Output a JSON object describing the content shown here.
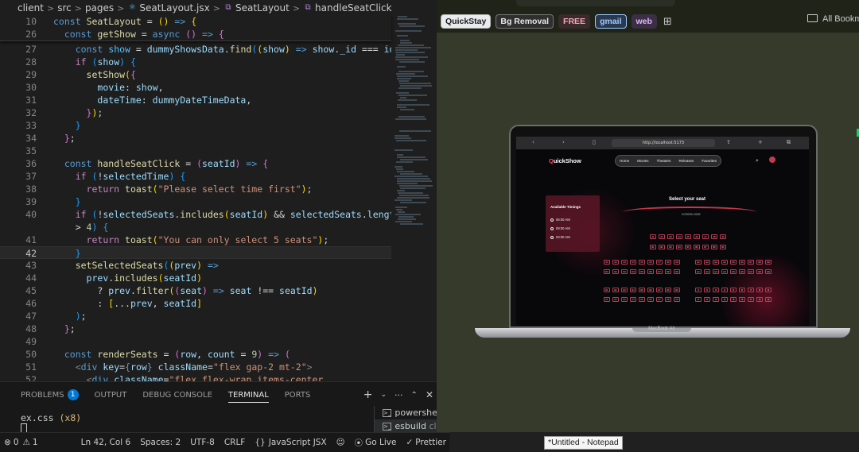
{
  "editor": {
    "breadcrumb": [
      "client",
      "src",
      "pages",
      "SeatLayout.jsx",
      "SeatLayout",
      "handleSeatClick"
    ],
    "sticky": [
      {
        "ln": "10",
        "html": "<span class='k'>const</span> <span class='f'>SeatLayout</span> = <span class='y'>()</span> <span class='k'>=&gt;</span> <span class='y'>{</span>"
      },
      {
        "ln": "26",
        "html": "  <span class='k'>const</span> <span class='f'>getShow</span> = <span class='k'>async</span> <span class='p'>()</span> <span class='k'>=&gt;</span> <span class='p'>{</span>"
      }
    ],
    "lines": [
      {
        "ln": "27",
        "html": "    <span class='k'>const</span> <span class='cst'>show</span> = <span class='v'>dummyShowsData</span>.<span class='f'>find</span><span class='b'>(</span><span class='y'>(</span><span class='v'>show</span><span class='y'>)</span> <span class='k'>=&gt;</span> <span class='v'>show</span>.<span class='v'>_id</span> === <span class='v'>id</span><span class='b'>)</span>;"
      },
      {
        "ln": "28",
        "html": "    <span class='c'>if</span> <span class='b'>(</span><span class='v'>show</span><span class='b'>)</span> <span class='b'>{</span>"
      },
      {
        "ln": "29",
        "html": "      <span class='f'>setShow</span><span class='y'>(</span><span class='p'>{</span>"
      },
      {
        "ln": "30",
        "html": "        <span class='v'>movie</span>: <span class='v'>show</span>,"
      },
      {
        "ln": "31",
        "html": "        <span class='v'>dateTime</span>: <span class='v'>dummyDateTimeData</span>,"
      },
      {
        "ln": "32",
        "html": "      <span class='p'>}</span><span class='y'>)</span>;"
      },
      {
        "ln": "33",
        "html": "    <span class='b'>}</span>"
      },
      {
        "ln": "34",
        "html": "  <span class='p'>}</span>;"
      },
      {
        "ln": "35",
        "html": ""
      },
      {
        "ln": "36",
        "html": "  <span class='k'>const</span> <span class='f'>handleSeatClick</span> = <span class='p'>(</span><span class='v'>seatId</span><span class='p'>)</span> <span class='k'>=&gt;</span> <span class='p'>{</span>"
      },
      {
        "ln": "37",
        "html": "    <span class='c'>if</span> <span class='b'>(</span>!<span class='v'>selectedTime</span><span class='b'>)</span> <span class='b'>{</span>"
      },
      {
        "ln": "38",
        "html": "      <span class='c'>return</span> <span class='f'>toast</span><span class='y'>(</span><span class='s'>\"Please select time first\"</span><span class='y'>)</span>;"
      },
      {
        "ln": "39",
        "html": "    <span class='b'>}</span>"
      },
      {
        "ln": "40",
        "html": "    <span class='c'>if</span> <span class='b'>(</span>!<span class='v'>selectedSeats</span>.<span class='f'>includes</span><span class='y'>(</span><span class='v'>seatId</span><span class='y'>)</span> &amp;&amp; <span class='v'>selectedSeats</span>.<span class='v'>length</span>"
      },
      {
        "ln": "",
        "html": "    &gt; <span class='n'>4</span><span class='b'>)</span> <span class='b'>{</span>"
      },
      {
        "ln": "41",
        "html": "      <span class='c'>return</span> <span class='f'>toast</span><span class='y'>(</span><span class='s'>\"You can only select 5 seats\"</span><span class='y'>)</span>;"
      },
      {
        "ln": "42",
        "html": "    <span class='b'>}</span>",
        "active": true
      },
      {
        "ln": "43",
        "html": "    <span class='f'>setSelectedSeats</span><span class='b'>(</span><span class='y'>(</span><span class='v'>prev</span><span class='y'>)</span> <span class='k'>=&gt;</span>"
      },
      {
        "ln": "44",
        "html": "      <span class='v'>prev</span>.<span class='f'>includes</span><span class='y'>(</span><span class='v'>seatId</span><span class='y'>)</span>"
      },
      {
        "ln": "45",
        "html": "        ? <span class='v'>prev</span>.<span class='f'>filter</span><span class='y'>(</span><span class='p'>(</span><span class='v'>seat</span><span class='p'>)</span> <span class='k'>=&gt;</span> <span class='v'>seat</span> !== <span class='v'>seatId</span><span class='y'>)</span>"
      },
      {
        "ln": "46",
        "html": "        : <span class='y'>[</span>...<span class='v'>prev</span>, <span class='v'>seatId</span><span class='y'>]</span>"
      },
      {
        "ln": "47",
        "html": "    <span class='b'>)</span>;"
      },
      {
        "ln": "48",
        "html": "  <span class='p'>}</span>;"
      },
      {
        "ln": "49",
        "html": ""
      },
      {
        "ln": "50",
        "html": "  <span class='k'>const</span> <span class='f'>renderSeats</span> = <span class='p'>(</span><span class='v'>row</span>, <span class='v'>count</span> = <span class='n'>9</span><span class='p'>)</span> <span class='k'>=&gt;</span> <span class='p'>(</span>"
      },
      {
        "ln": "51",
        "html": "    <span class='g'>&lt;</span><span class='k'>div</span> <span class='v'>key</span>=<span class='k'>{</span><span class='v'>row</span><span class='k'>}</span> <span class='v'>className</span>=<span class='s'>\"flex gap-2 mt-2\"</span><span class='g'>&gt;</span>"
      },
      {
        "ln": "52",
        "html": "      <span class='g'>&lt;</span><span class='k'>div</span> <span class='v'>className</span>=<span class='s'>\"flex flex-wrap items-center</span>"
      }
    ],
    "panel": {
      "tabs": [
        "PROBLEMS",
        "OUTPUT",
        "DEBUG CONSOLE",
        "TERMINAL",
        "PORTS"
      ],
      "problems_count": "1",
      "terminal_text": "ex.css",
      "terminal_suffix": "(x8)",
      "terminals": [
        "powershell",
        "esbuild"
      ],
      "esbuild_suffix": "cli"
    },
    "status": {
      "errors": "0",
      "warnings": "1",
      "position": "Ln 42, Col 6",
      "spaces": "Spaces: 2",
      "encoding": "UTF-8",
      "eol": "CRLF",
      "language": "JavaScript JSX",
      "golive": "Go Live",
      "prettier": "Prettier"
    }
  },
  "browser": {
    "bookmarks": [
      {
        "label": "QuickStay",
        "bg": "#e9ecef",
        "fg": "#1a1a1a",
        "border": "#b8b8b8"
      },
      {
        "label": "Bg Removal",
        "bg": "#2f2f2f",
        "fg": "#e8e8e8",
        "border": "#777777"
      },
      {
        "label": "FREE",
        "bg": "#3b2a2c",
        "fg": "#f2a7b4",
        "border": "#3b2a2c"
      },
      {
        "label": "gmail",
        "bg": "#2a3950",
        "fg": "#9ecbff",
        "border": "#9ecbff"
      },
      {
        "label": "web",
        "bg": "#3b2f45",
        "fg": "#e4b4ff",
        "border": "#3b2f45"
      }
    ],
    "all_bookmarks": "All Bookm",
    "mock": {
      "url": "http://localhost:5173",
      "tab_label": "aA",
      "logo_q": "Q",
      "logo_rest": "uickShow",
      "nav": [
        "Home",
        "Movies",
        "Theaters",
        "Releases",
        "Favorites"
      ],
      "timings_title": "Available Timings",
      "times": [
        "06:00 AM",
        "09:00 AM",
        "03:00 AM"
      ],
      "select_title": "Select your seat",
      "screen_side": "SCREEN SIDE",
      "device": "MacBook Air",
      "rows_main": [
        "A",
        "B"
      ],
      "rows_left": [
        "C",
        "D",
        "E",
        "F"
      ],
      "rows_right": [
        "G",
        "H",
        "I",
        "J"
      ]
    }
  },
  "taskbar": {
    "tooltip": "*Untitled - Notepad"
  }
}
